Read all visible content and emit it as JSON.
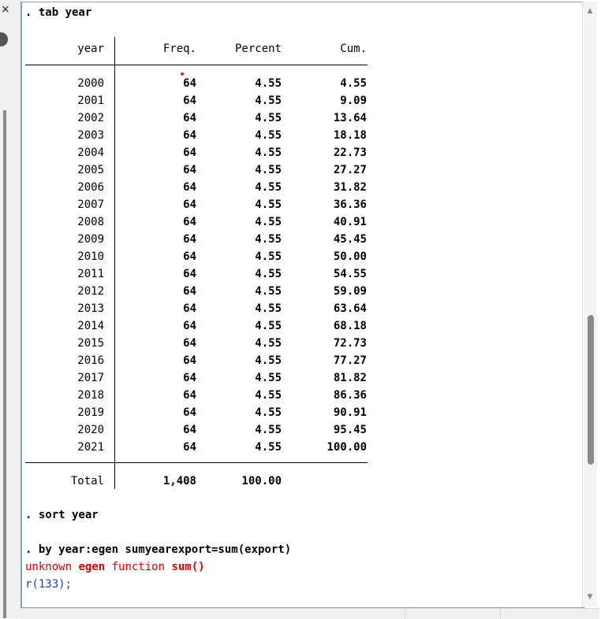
{
  "results": {
    "cmd_tab": ". tab year",
    "table": {
      "headers": [
        "year",
        "Freq.",
        "Percent",
        "Cum."
      ],
      "rows": [
        [
          "2000",
          "64",
          "4.55",
          "4.55"
        ],
        [
          "2001",
          "64",
          "4.55",
          "9.09"
        ],
        [
          "2002",
          "64",
          "4.55",
          "13.64"
        ],
        [
          "2003",
          "64",
          "4.55",
          "18.18"
        ],
        [
          "2004",
          "64",
          "4.55",
          "22.73"
        ],
        [
          "2005",
          "64",
          "4.55",
          "27.27"
        ],
        [
          "2006",
          "64",
          "4.55",
          "31.82"
        ],
        [
          "2007",
          "64",
          "4.55",
          "36.36"
        ],
        [
          "2008",
          "64",
          "4.55",
          "40.91"
        ],
        [
          "2009",
          "64",
          "4.55",
          "45.45"
        ],
        [
          "2010",
          "64",
          "4.55",
          "50.00"
        ],
        [
          "2011",
          "64",
          "4.55",
          "54.55"
        ],
        [
          "2012",
          "64",
          "4.55",
          "59.09"
        ],
        [
          "2013",
          "64",
          "4.55",
          "63.64"
        ],
        [
          "2014",
          "64",
          "4.55",
          "68.18"
        ],
        [
          "2015",
          "64",
          "4.55",
          "72.73"
        ],
        [
          "2016",
          "64",
          "4.55",
          "77.27"
        ],
        [
          "2017",
          "64",
          "4.55",
          "81.82"
        ],
        [
          "2018",
          "64",
          "4.55",
          "86.36"
        ],
        [
          "2019",
          "64",
          "4.55",
          "90.91"
        ],
        [
          "2020",
          "64",
          "4.55",
          "95.45"
        ],
        [
          "2021",
          "64",
          "4.55",
          "100.00"
        ]
      ],
      "total": [
        "Total",
        "1,408",
        "100.00",
        ""
      ]
    },
    "cmd_sort": ". sort year",
    "cmd_egen": ". by year:egen sumyearexport=sum(export)",
    "error": {
      "part1": "unknown ",
      "part2": "egen",
      "part3": " function ",
      "part4": "sum()"
    },
    "return_code": "r(133);"
  },
  "window": {
    "close_glyph": "×"
  },
  "colors": {
    "error": "#e00000",
    "return_code": "#1e3ccf",
    "pane_border": "#7f9db9"
  }
}
